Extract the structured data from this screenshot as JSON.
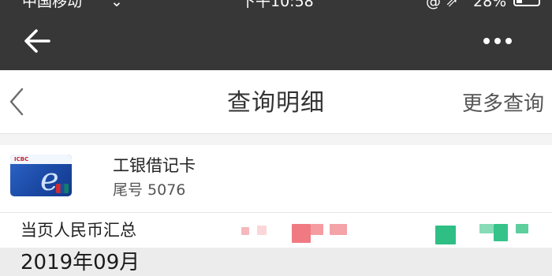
{
  "status_bar": {
    "carrier": "中国移动",
    "wifi_icon": "wifi-icon",
    "time": "下午10:58",
    "icons": "@ ⇗",
    "battery_percent": "28%"
  },
  "app_bar": {
    "back_icon": "arrow-left-icon",
    "more_icon": "more-dots-icon"
  },
  "nav": {
    "back_icon": "chevron-left-icon",
    "title": "查询明细",
    "more_query": "更多查询"
  },
  "card": {
    "name": "工银借记卡",
    "tail": "尾号 5076",
    "brand": "ICBC 中国工商银行",
    "colors": {
      "card_blue": "#1c4aa6",
      "icbc_red": "#c1272d"
    }
  },
  "summary": {
    "label": "当页人民币汇总",
    "expense_color": "#f07a82",
    "income_color": "#2fbf84"
  },
  "month": {
    "label": "2019年09月"
  }
}
